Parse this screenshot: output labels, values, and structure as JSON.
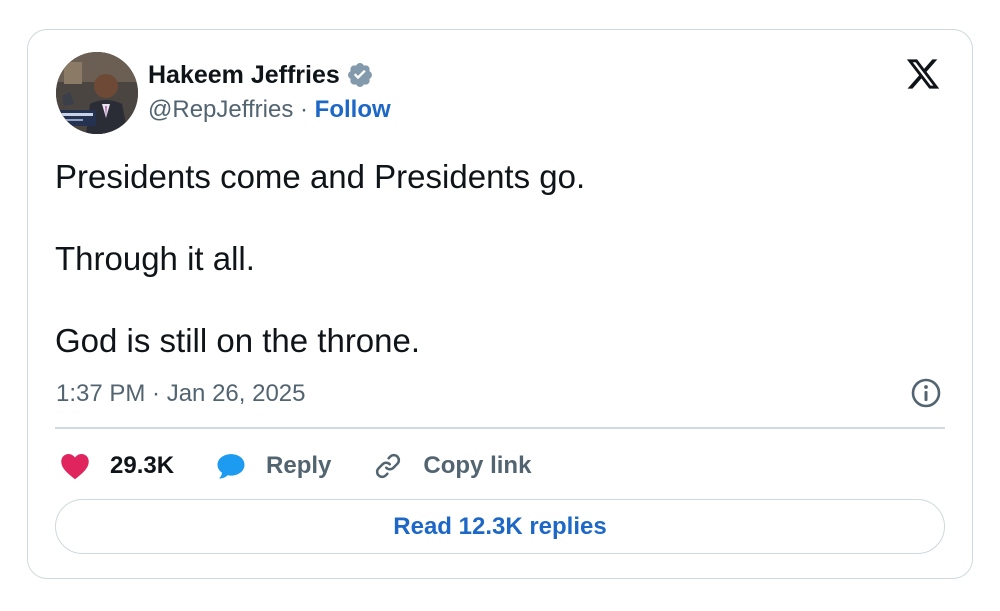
{
  "author": {
    "name": "Hakeem Jeffries",
    "handle": "@RepJeffries",
    "separator": "·",
    "follow_label": "Follow"
  },
  "tweet": {
    "paragraphs": [
      "Presidents come and Presidents go.",
      "Through it all.",
      "God is still on the throne."
    ],
    "timestamp": "1:37 PM · Jan 26, 2025"
  },
  "actions": {
    "likes_count": "29.3K",
    "reply_label": "Reply",
    "copy_link_label": "Copy link"
  },
  "read_replies_label": "Read 12.3K replies",
  "icons": {
    "verified": "verified-badge-icon",
    "logo": "x-logo-icon",
    "info": "info-icon",
    "like": "heart-icon",
    "reply": "speech-bubble-icon",
    "copy_link": "link-icon"
  },
  "colors": {
    "follow_link": "#1d68c7",
    "like_heart": "#e0245e",
    "reply_bubble": "#1d9bf0",
    "verified_badge": "#829aab",
    "muted_text": "#536471",
    "border": "#cfd9de"
  }
}
